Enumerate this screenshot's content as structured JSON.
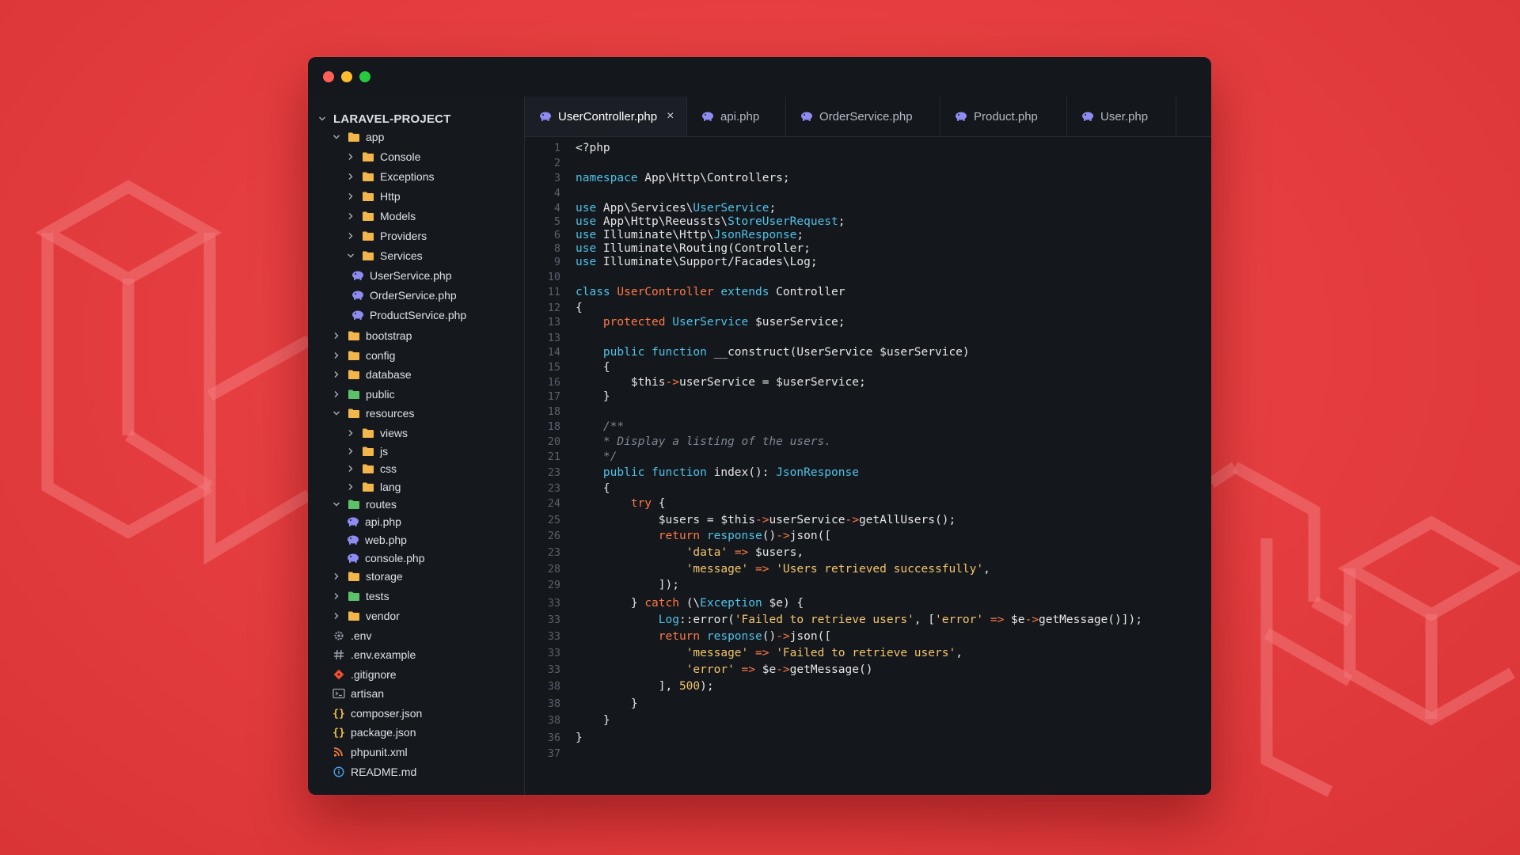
{
  "colors": {
    "background": "#e53d3f",
    "window": "#14171c",
    "keyword": "#4fc3e8",
    "class_name": "#ff7a45",
    "type": "#4fc3e8",
    "string": "#f5c66b",
    "comment": "#7e8794",
    "number": "#f5c66b",
    "plain": "#e6e6e6",
    "php_icon": "#8e8cf0",
    "folder": "#f2b64a",
    "folder_green": "#5cc26a"
  },
  "window": {
    "controls": [
      "close",
      "minimize",
      "maximize"
    ]
  },
  "sidebar": {
    "rows": [
      {
        "label": "LARAVEL-PROJECT",
        "indent": 0,
        "chevron": "down",
        "icon": "none",
        "root": true
      },
      {
        "label": "app",
        "indent": 1,
        "chevron": "down",
        "icon": "folder"
      },
      {
        "label": "Console",
        "indent": 2,
        "chevron": "right",
        "icon": "folder"
      },
      {
        "label": "Exceptions",
        "indent": 2,
        "chevron": "right",
        "icon": "folder"
      },
      {
        "label": "Http",
        "indent": 2,
        "chevron": "right",
        "icon": "folder"
      },
      {
        "label": "Models",
        "indent": 2,
        "chevron": "right",
        "icon": "folder"
      },
      {
        "label": "Providers",
        "indent": 2,
        "chevron": "right",
        "icon": "folder"
      },
      {
        "label": "Services",
        "indent": 2,
        "chevron": "down",
        "icon": "folder"
      },
      {
        "label": "UserService.php",
        "indent": 3,
        "chevron": "none",
        "icon": "php"
      },
      {
        "label": "OrderService.php",
        "indent": 3,
        "chevron": "none",
        "icon": "php"
      },
      {
        "label": "ProductService.php",
        "indent": 3,
        "chevron": "none",
        "icon": "php"
      },
      {
        "label": "bootstrap",
        "indent": 1,
        "chevron": "right",
        "icon": "folder"
      },
      {
        "label": "config",
        "indent": 1,
        "chevron": "right",
        "icon": "folder"
      },
      {
        "label": "database",
        "indent": 1,
        "chevron": "right",
        "icon": "folder"
      },
      {
        "label": "public",
        "indent": 1,
        "chevron": "right",
        "icon": "folder-green"
      },
      {
        "label": "resources",
        "indent": 1,
        "chevron": "down",
        "icon": "folder"
      },
      {
        "label": "views",
        "indent": 2,
        "chevron": "right",
        "icon": "folder"
      },
      {
        "label": "js",
        "indent": 2,
        "chevron": "right",
        "icon": "folder"
      },
      {
        "label": "css",
        "indent": 2,
        "chevron": "right",
        "icon": "folder"
      },
      {
        "label": "lang",
        "indent": 2,
        "chevron": "right",
        "icon": "folder"
      },
      {
        "label": "routes",
        "indent": 1,
        "chevron": "down",
        "icon": "folder-green"
      },
      {
        "label": "api.php",
        "indent": 2,
        "chevron": "none",
        "icon": "php"
      },
      {
        "label": "web.php",
        "indent": 2,
        "chevron": "none",
        "icon": "php"
      },
      {
        "label": "console.php",
        "indent": 2,
        "chevron": "none",
        "icon": "php"
      },
      {
        "label": "storage",
        "indent": 1,
        "chevron": "right",
        "icon": "folder"
      },
      {
        "label": "tests",
        "indent": 1,
        "chevron": "right",
        "icon": "folder-green"
      },
      {
        "label": "vendor",
        "indent": 1,
        "chevron": "right",
        "icon": "folder"
      },
      {
        "label": ".env",
        "indent": 1,
        "chevron": "none",
        "icon": "gear"
      },
      {
        "label": ".env.example",
        "indent": 1,
        "chevron": "none",
        "icon": "hash"
      },
      {
        "label": ".gitignore",
        "indent": 1,
        "chevron": "none",
        "icon": "git"
      },
      {
        "label": "artisan",
        "indent": 1,
        "chevron": "none",
        "icon": "terminal"
      },
      {
        "label": "composer.json",
        "indent": 1,
        "chevron": "none",
        "icon": "braces"
      },
      {
        "label": "package.json",
        "indent": 1,
        "chevron": "none",
        "icon": "braces"
      },
      {
        "label": "phpunit.xml",
        "indent": 1,
        "chevron": "none",
        "icon": "rss"
      },
      {
        "label": "README.md",
        "indent": 1,
        "chevron": "none",
        "icon": "info"
      }
    ]
  },
  "tabs": [
    {
      "label": "UserController.php",
      "active": true,
      "close": "×"
    },
    {
      "label": "api.php",
      "active": false
    },
    {
      "label": "OrderService.php",
      "active": false
    },
    {
      "label": "Product.php",
      "active": false
    },
    {
      "label": "User.php",
      "active": false
    }
  ],
  "editor": {
    "lines": [
      {
        "n": "1",
        "t": [
          [
            "p",
            "<?php"
          ]
        ]
      },
      {
        "n": "2",
        "t": []
      },
      {
        "n": "3",
        "t": [
          [
            "k",
            "namespace"
          ],
          [
            "p",
            " App\\Http\\Controllers;"
          ]
        ]
      },
      {
        "n": "4",
        "t": []
      },
      {
        "n": "4",
        "t": [
          [
            "k",
            "use"
          ],
          [
            "p",
            " App\\Services\\"
          ],
          [
            "y",
            "UserService"
          ],
          [
            "p",
            ";"
          ]
        ]
      },
      {
        "n": "5",
        "t": [
          [
            "k",
            "use"
          ],
          [
            "p",
            " App\\Http\\Reeussts\\"
          ],
          [
            "y",
            "StoreUserRequest"
          ],
          [
            "p",
            ";"
          ]
        ]
      },
      {
        "n": "6",
        "t": [
          [
            "k",
            "use"
          ],
          [
            "p",
            " Illuminate\\Http\\"
          ],
          [
            "y",
            "JsonResponse"
          ],
          [
            "p",
            ";"
          ]
        ]
      },
      {
        "n": "8",
        "t": [
          [
            "k",
            "use"
          ],
          [
            "p",
            " Illuminate\\Routing(Controller;"
          ]
        ]
      },
      {
        "n": "9",
        "t": [
          [
            "k",
            "use"
          ],
          [
            "p",
            " Illuminate\\Support/Facades\\Log;"
          ]
        ]
      },
      {
        "n": "10",
        "t": []
      },
      {
        "n": "11",
        "t": [
          [
            "k",
            "class"
          ],
          [
            "p",
            " "
          ],
          [
            "c",
            "UserController"
          ],
          [
            "p",
            " "
          ],
          [
            "k",
            "extends"
          ],
          [
            "p",
            " Controller"
          ]
        ]
      },
      {
        "n": "12",
        "t": [
          [
            "p",
            "{"
          ]
        ]
      },
      {
        "n": "13",
        "t": [
          [
            "p",
            "    "
          ],
          [
            "c",
            "protected"
          ],
          [
            "p",
            " "
          ],
          [
            "y",
            "UserService"
          ],
          [
            "p",
            " $userService;"
          ]
        ]
      },
      {
        "n": "13",
        "t": []
      },
      {
        "n": "14",
        "t": [
          [
            "p",
            "    "
          ],
          [
            "k",
            "public"
          ],
          [
            "p",
            " "
          ],
          [
            "k",
            "function"
          ],
          [
            "p",
            " __construct(UserService "
          ],
          [
            "p",
            "$userService)"
          ]
        ]
      },
      {
        "n": "15",
        "t": [
          [
            "p",
            "    {"
          ]
        ]
      },
      {
        "n": "16",
        "t": [
          [
            "p",
            "        $this"
          ],
          [
            "c",
            "->"
          ],
          [
            "p",
            "userService = $userService;"
          ]
        ]
      },
      {
        "n": "17",
        "t": [
          [
            "p",
            "    }"
          ]
        ]
      },
      {
        "n": "18",
        "t": []
      },
      {
        "n": "18",
        "t": [
          [
            "m",
            "    /**"
          ]
        ]
      },
      {
        "n": "20",
        "t": [
          [
            "m",
            "    * Display a listing of the users."
          ]
        ]
      },
      {
        "n": "21",
        "t": [
          [
            "m",
            "    */"
          ]
        ]
      },
      {
        "n": "23",
        "t": [
          [
            "p",
            "    "
          ],
          [
            "k",
            "public"
          ],
          [
            "p",
            " "
          ],
          [
            "k",
            "function"
          ],
          [
            "p",
            " index(): "
          ],
          [
            "y",
            "JsonResponse"
          ]
        ]
      },
      {
        "n": "23",
        "t": [
          [
            "p",
            "    {"
          ]
        ]
      },
      {
        "n": "24",
        "t": [
          [
            "p",
            "        "
          ],
          [
            "c",
            "try"
          ],
          [
            "p",
            " {"
          ]
        ]
      },
      {
        "n": "25",
        "t": [
          [
            "p",
            "            $users = $this"
          ],
          [
            "c",
            "->"
          ],
          [
            "p",
            "userService"
          ],
          [
            "c",
            "->"
          ],
          [
            "p",
            "getAllUsers();"
          ]
        ]
      },
      {
        "n": "26",
        "t": [
          [
            "p",
            "            "
          ],
          [
            "c",
            "return"
          ],
          [
            "p",
            " "
          ],
          [
            "k",
            "response"
          ],
          [
            "p",
            "()"
          ],
          [
            "c",
            "->"
          ],
          [
            "p",
            "json(["
          ]
        ]
      },
      {
        "n": "23",
        "t": [
          [
            "p",
            "                "
          ],
          [
            "s",
            "'data'"
          ],
          [
            "p",
            " "
          ],
          [
            "c",
            "=>"
          ],
          [
            "p",
            " $users,"
          ]
        ]
      },
      {
        "n": "28",
        "t": [
          [
            "p",
            "                "
          ],
          [
            "s",
            "'message'"
          ],
          [
            "p",
            " "
          ],
          [
            "c",
            "=>"
          ],
          [
            "p",
            " "
          ],
          [
            "s",
            "'Users retrieved successfully'"
          ],
          [
            "p",
            ","
          ]
        ]
      },
      {
        "n": "29",
        "t": [
          [
            "p",
            "            ]);"
          ]
        ]
      },
      {
        "n": "33",
        "t": [
          [
            "p",
            "        } "
          ],
          [
            "c",
            "catch"
          ],
          [
            "p",
            " (\\"
          ],
          [
            "y",
            "Exception"
          ],
          [
            "p",
            " $e) {"
          ]
        ]
      },
      {
        "n": "33",
        "t": [
          [
            "p",
            "            "
          ],
          [
            "y",
            "Log"
          ],
          [
            "p",
            "::error("
          ],
          [
            "s",
            "'Failed to retrieve users'"
          ],
          [
            "p",
            ", ["
          ],
          [
            "s",
            "'error'"
          ],
          [
            "p",
            " "
          ],
          [
            "c",
            "=>"
          ],
          [
            "p",
            " $e"
          ],
          [
            "c",
            "->"
          ],
          [
            "p",
            "getMessage()]);"
          ]
        ]
      },
      {
        "n": "33",
        "t": [
          [
            "p",
            "            "
          ],
          [
            "c",
            "return"
          ],
          [
            "p",
            " "
          ],
          [
            "k",
            "response"
          ],
          [
            "p",
            "()"
          ],
          [
            "c",
            "->"
          ],
          [
            "p",
            "json(["
          ]
        ]
      },
      {
        "n": "33",
        "t": [
          [
            "p",
            "                "
          ],
          [
            "s",
            "'message'"
          ],
          [
            "p",
            " "
          ],
          [
            "c",
            "=>"
          ],
          [
            "p",
            " "
          ],
          [
            "s",
            "'Failed to retrieve users'"
          ],
          [
            "p",
            ","
          ]
        ]
      },
      {
        "n": "33",
        "t": [
          [
            "p",
            "                "
          ],
          [
            "s",
            "'error'"
          ],
          [
            "p",
            " "
          ],
          [
            "c",
            "=>"
          ],
          [
            "p",
            " $e"
          ],
          [
            "c",
            "->"
          ],
          [
            "p",
            "getMessage()"
          ]
        ]
      },
      {
        "n": "38",
        "t": [
          [
            "p",
            "            ], "
          ],
          [
            "s",
            "500"
          ],
          [
            "p",
            ");"
          ]
        ]
      },
      {
        "n": "38",
        "t": [
          [
            "p",
            "        }"
          ]
        ]
      },
      {
        "n": "38",
        "t": [
          [
            "p",
            "    }"
          ]
        ]
      },
      {
        "n": "36",
        "t": [
          [
            "p",
            "}"
          ]
        ]
      },
      {
        "n": "37",
        "t": []
      }
    ]
  }
}
